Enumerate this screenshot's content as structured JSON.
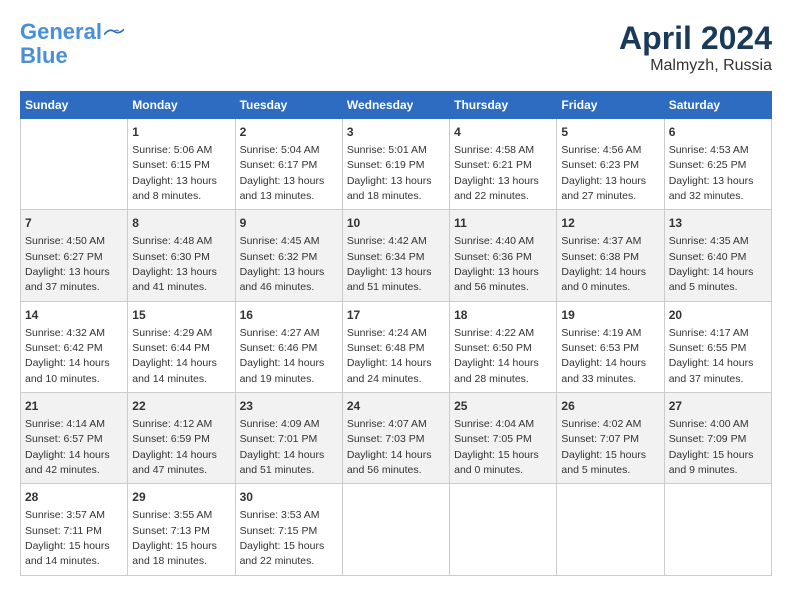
{
  "logo": {
    "line1": "General",
    "line2": "Blue"
  },
  "title": "April 2024",
  "subtitle": "Malmyzh, Russia",
  "columns": [
    "Sunday",
    "Monday",
    "Tuesday",
    "Wednesday",
    "Thursday",
    "Friday",
    "Saturday"
  ],
  "weeks": [
    [
      {
        "day": "",
        "info": ""
      },
      {
        "day": "1",
        "info": "Sunrise: 5:06 AM\nSunset: 6:15 PM\nDaylight: 13 hours\nand 8 minutes."
      },
      {
        "day": "2",
        "info": "Sunrise: 5:04 AM\nSunset: 6:17 PM\nDaylight: 13 hours\nand 13 minutes."
      },
      {
        "day": "3",
        "info": "Sunrise: 5:01 AM\nSunset: 6:19 PM\nDaylight: 13 hours\nand 18 minutes."
      },
      {
        "day": "4",
        "info": "Sunrise: 4:58 AM\nSunset: 6:21 PM\nDaylight: 13 hours\nand 22 minutes."
      },
      {
        "day": "5",
        "info": "Sunrise: 4:56 AM\nSunset: 6:23 PM\nDaylight: 13 hours\nand 27 minutes."
      },
      {
        "day": "6",
        "info": "Sunrise: 4:53 AM\nSunset: 6:25 PM\nDaylight: 13 hours\nand 32 minutes."
      }
    ],
    [
      {
        "day": "7",
        "info": "Sunrise: 4:50 AM\nSunset: 6:27 PM\nDaylight: 13 hours\nand 37 minutes."
      },
      {
        "day": "8",
        "info": "Sunrise: 4:48 AM\nSunset: 6:30 PM\nDaylight: 13 hours\nand 41 minutes."
      },
      {
        "day": "9",
        "info": "Sunrise: 4:45 AM\nSunset: 6:32 PM\nDaylight: 13 hours\nand 46 minutes."
      },
      {
        "day": "10",
        "info": "Sunrise: 4:42 AM\nSunset: 6:34 PM\nDaylight: 13 hours\nand 51 minutes."
      },
      {
        "day": "11",
        "info": "Sunrise: 4:40 AM\nSunset: 6:36 PM\nDaylight: 13 hours\nand 56 minutes."
      },
      {
        "day": "12",
        "info": "Sunrise: 4:37 AM\nSunset: 6:38 PM\nDaylight: 14 hours\nand 0 minutes."
      },
      {
        "day": "13",
        "info": "Sunrise: 4:35 AM\nSunset: 6:40 PM\nDaylight: 14 hours\nand 5 minutes."
      }
    ],
    [
      {
        "day": "14",
        "info": "Sunrise: 4:32 AM\nSunset: 6:42 PM\nDaylight: 14 hours\nand 10 minutes."
      },
      {
        "day": "15",
        "info": "Sunrise: 4:29 AM\nSunset: 6:44 PM\nDaylight: 14 hours\nand 14 minutes."
      },
      {
        "day": "16",
        "info": "Sunrise: 4:27 AM\nSunset: 6:46 PM\nDaylight: 14 hours\nand 19 minutes."
      },
      {
        "day": "17",
        "info": "Sunrise: 4:24 AM\nSunset: 6:48 PM\nDaylight: 14 hours\nand 24 minutes."
      },
      {
        "day": "18",
        "info": "Sunrise: 4:22 AM\nSunset: 6:50 PM\nDaylight: 14 hours\nand 28 minutes."
      },
      {
        "day": "19",
        "info": "Sunrise: 4:19 AM\nSunset: 6:53 PM\nDaylight: 14 hours\nand 33 minutes."
      },
      {
        "day": "20",
        "info": "Sunrise: 4:17 AM\nSunset: 6:55 PM\nDaylight: 14 hours\nand 37 minutes."
      }
    ],
    [
      {
        "day": "21",
        "info": "Sunrise: 4:14 AM\nSunset: 6:57 PM\nDaylight: 14 hours\nand 42 minutes."
      },
      {
        "day": "22",
        "info": "Sunrise: 4:12 AM\nSunset: 6:59 PM\nDaylight: 14 hours\nand 47 minutes."
      },
      {
        "day": "23",
        "info": "Sunrise: 4:09 AM\nSunset: 7:01 PM\nDaylight: 14 hours\nand 51 minutes."
      },
      {
        "day": "24",
        "info": "Sunrise: 4:07 AM\nSunset: 7:03 PM\nDaylight: 14 hours\nand 56 minutes."
      },
      {
        "day": "25",
        "info": "Sunrise: 4:04 AM\nSunset: 7:05 PM\nDaylight: 15 hours\nand 0 minutes."
      },
      {
        "day": "26",
        "info": "Sunrise: 4:02 AM\nSunset: 7:07 PM\nDaylight: 15 hours\nand 5 minutes."
      },
      {
        "day": "27",
        "info": "Sunrise: 4:00 AM\nSunset: 7:09 PM\nDaylight: 15 hours\nand 9 minutes."
      }
    ],
    [
      {
        "day": "28",
        "info": "Sunrise: 3:57 AM\nSunset: 7:11 PM\nDaylight: 15 hours\nand 14 minutes."
      },
      {
        "day": "29",
        "info": "Sunrise: 3:55 AM\nSunset: 7:13 PM\nDaylight: 15 hours\nand 18 minutes."
      },
      {
        "day": "30",
        "info": "Sunrise: 3:53 AM\nSunset: 7:15 PM\nDaylight: 15 hours\nand 22 minutes."
      },
      {
        "day": "",
        "info": ""
      },
      {
        "day": "",
        "info": ""
      },
      {
        "day": "",
        "info": ""
      },
      {
        "day": "",
        "info": ""
      }
    ]
  ]
}
